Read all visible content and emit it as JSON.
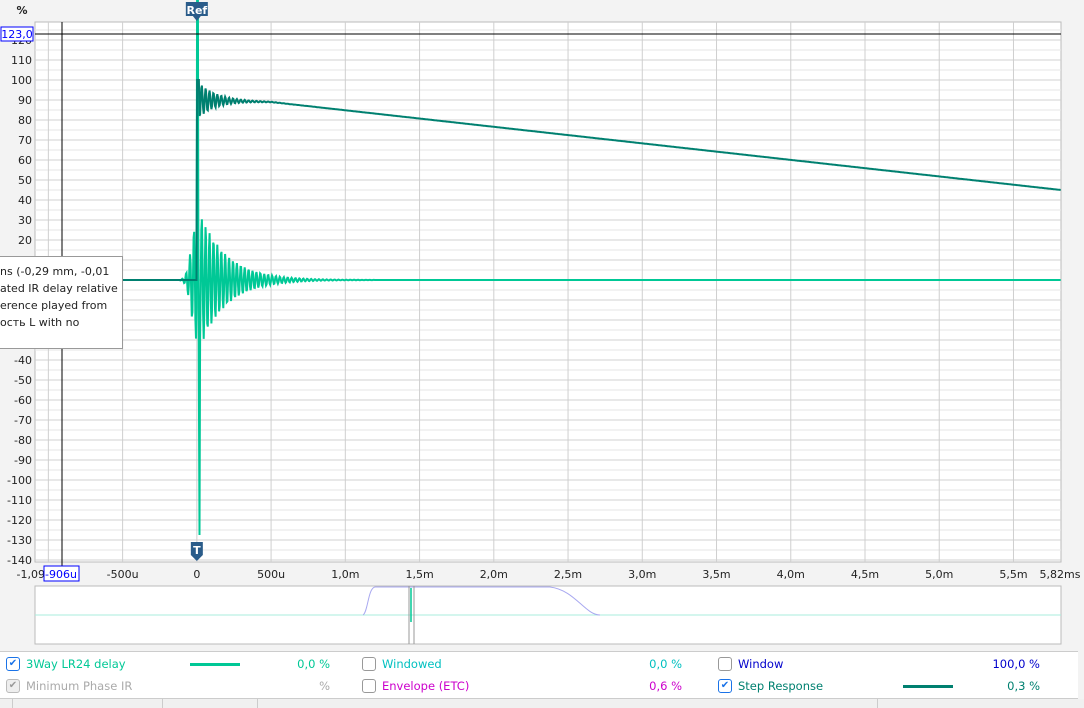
{
  "y_unit": "%",
  "ref_marker": "Ref",
  "t_marker": "T",
  "cursor": {
    "y_readout": "123,0",
    "x_readout": "-906u"
  },
  "tooltip_lines": [
    "ns (-0,29 mm, -0,01",
    "ated IR delay relative",
    "erence played from",
    "ость L with no"
  ],
  "chart_data": {
    "type": "line",
    "xlim_ms": [
      -1.09,
      5.82
    ],
    "ylim": [
      -141,
      129
    ],
    "grid": true,
    "y_ticks": [
      120,
      110,
      100,
      90,
      80,
      70,
      60,
      50,
      40,
      30,
      20,
      10,
      0,
      -10,
      -20,
      -30,
      -40,
      -50,
      -60,
      -70,
      -80,
      -90,
      -100,
      -110,
      -120,
      -130,
      -140
    ],
    "x_tick_labels": [
      "-1,09",
      "-500u",
      "0",
      "500u",
      "1,0m",
      "1,5m",
      "2,0m",
      "2,5m",
      "3,0m",
      "3,5m",
      "4,0m",
      "4,5m",
      "5,0m",
      "5,5m",
      "5,82ms"
    ],
    "x_tick_values_ms": [
      -1.09,
      -0.5,
      0,
      0.5,
      1.0,
      1.5,
      2.0,
      2.5,
      3.0,
      3.5,
      4.0,
      4.5,
      5.0,
      5.5,
      5.82
    ],
    "series": [
      {
        "name": "3Way LR24 delay",
        "color": "#00c896",
        "kind": "impulse",
        "peak": 100,
        "min": -36,
        "settle_ms": 1.0,
        "baseline": 0
      },
      {
        "name": "Step Response",
        "color": "#008070",
        "points_ms_pct": [
          [
            -1.09,
            0
          ],
          [
            -0.1,
            0
          ],
          [
            0,
            100
          ],
          [
            0.1,
            88
          ],
          [
            0.25,
            92
          ],
          [
            0.5,
            89
          ],
          [
            1.0,
            84.9
          ],
          [
            2.0,
            76.6
          ],
          [
            3.0,
            68.3
          ],
          [
            4.0,
            60.0
          ],
          [
            5.0,
            51.8
          ],
          [
            5.82,
            45
          ]
        ]
      }
    ]
  },
  "legend": {
    "items": [
      {
        "label": "3Way LR24 delay",
        "value": "0,0 %",
        "checked": true,
        "color": "#00c896"
      },
      {
        "label": "Minimum Phase IR",
        "value": "%",
        "checked": true,
        "color": "#aaaaaa"
      },
      {
        "label": "Windowed",
        "value": "0,0 %",
        "checked": false,
        "color": "#00c0c0"
      },
      {
        "label": "Envelope (ETC)",
        "value": "0,6 %",
        "checked": false,
        "color": "#cc00cc"
      },
      {
        "label": "Window",
        "value": "100,0 %",
        "checked": false,
        "color": "#0000cc"
      },
      {
        "label": "Step Response",
        "value": "0,3 %",
        "checked": true,
        "color": "#008070"
      }
    ]
  }
}
